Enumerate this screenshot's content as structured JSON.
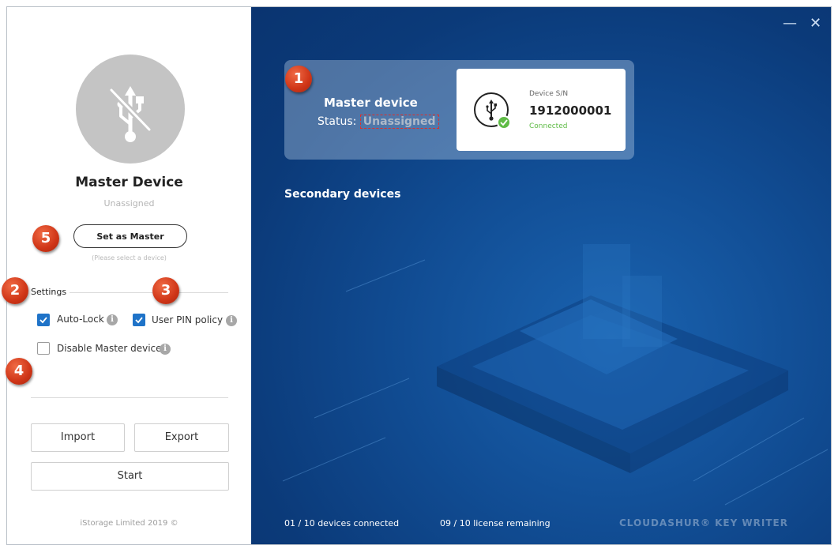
{
  "left_panel": {
    "title": "Master Device",
    "status": "Unassigned",
    "set_master_button": "Set as Master",
    "hint": "(Please select a device)",
    "settings_label": "Settings",
    "options": {
      "auto_lock": {
        "label": "Auto-Lock",
        "checked": true
      },
      "user_pin_policy": {
        "label": "User PIN policy",
        "checked": true
      },
      "disable_master": {
        "label": "Disable Master device",
        "checked": false
      }
    },
    "import_button": "Import",
    "export_button": "Export",
    "start_button": "Start",
    "footer": "iStorage Limited 2019 ©"
  },
  "window_controls": {
    "minimize": "—",
    "close": "✕"
  },
  "master_card": {
    "title": "Master device",
    "status_label": "Status:",
    "status_value": "Unassigned",
    "device": {
      "sn_label": "Device S/N",
      "serial": "1912000001",
      "connection": "Connected"
    }
  },
  "secondary_title": "Secondary devices",
  "footer": {
    "devices_connected": "01 / 10 devices connected",
    "license_remaining": "09 / 10 license remaining",
    "brand": "CLOUDASHUR® KEY WRITER"
  },
  "callouts": [
    "1",
    "2",
    "3",
    "4",
    "5"
  ],
  "colors": {
    "accent_blue": "#1f73c8",
    "panel_blue": "#114d94",
    "connected_green": "#5fbb46",
    "callout_red": "#cf3517"
  }
}
